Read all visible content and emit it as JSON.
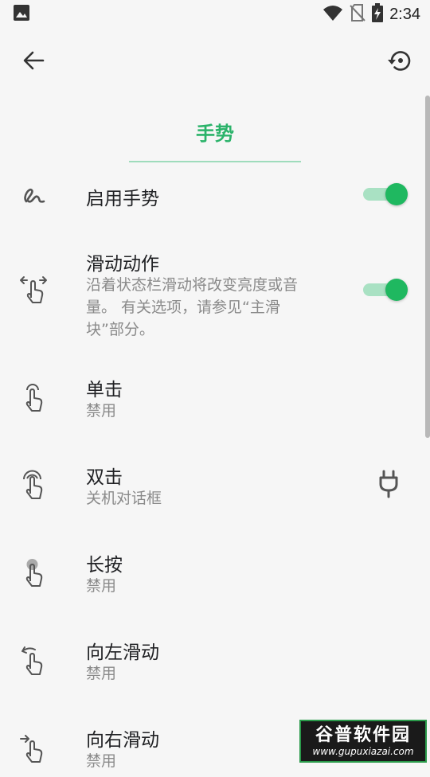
{
  "status_bar": {
    "time": "2:34",
    "left_icons": [
      "image-icon"
    ],
    "right_icons": [
      "wifi-icon",
      "no-sim-icon",
      "battery-charging-icon"
    ]
  },
  "toolbar": {
    "back_icon": "arrow-left-icon",
    "reset_icon": "restore-icon"
  },
  "header": {
    "title": "手势"
  },
  "colors": {
    "accent": "#2bb36a",
    "toggle_thumb": "#1fb860",
    "toggle_track": "#a9e1c3",
    "background": "#f6f6f6"
  },
  "settings": [
    {
      "title": "启用手势",
      "icon": "squiggle-gesture-icon",
      "toggle": true
    },
    {
      "title": "滑动动作",
      "subtitle": "沿着状态栏滑动将改变亮度或音量。 有关选项，请参见“主滑块”部分。",
      "icon": "swipe-horizontal-icon",
      "toggle": true
    },
    {
      "title": "单击",
      "subtitle": "禁用",
      "icon": "single-tap-icon"
    },
    {
      "title": "双击",
      "subtitle": "关机对话框",
      "icon": "double-tap-icon",
      "trailing_icon": "power-plug-icon"
    },
    {
      "title": "长按",
      "subtitle": "禁用",
      "icon": "long-press-icon"
    },
    {
      "title": "向左滑动",
      "subtitle": "禁用",
      "icon": "swipe-left-icon"
    },
    {
      "title": "向右滑动",
      "subtitle": "禁用",
      "icon": "swipe-right-icon"
    }
  ],
  "watermark": {
    "main": "谷普软件园",
    "sub": "www.gupuxiazai.com"
  }
}
